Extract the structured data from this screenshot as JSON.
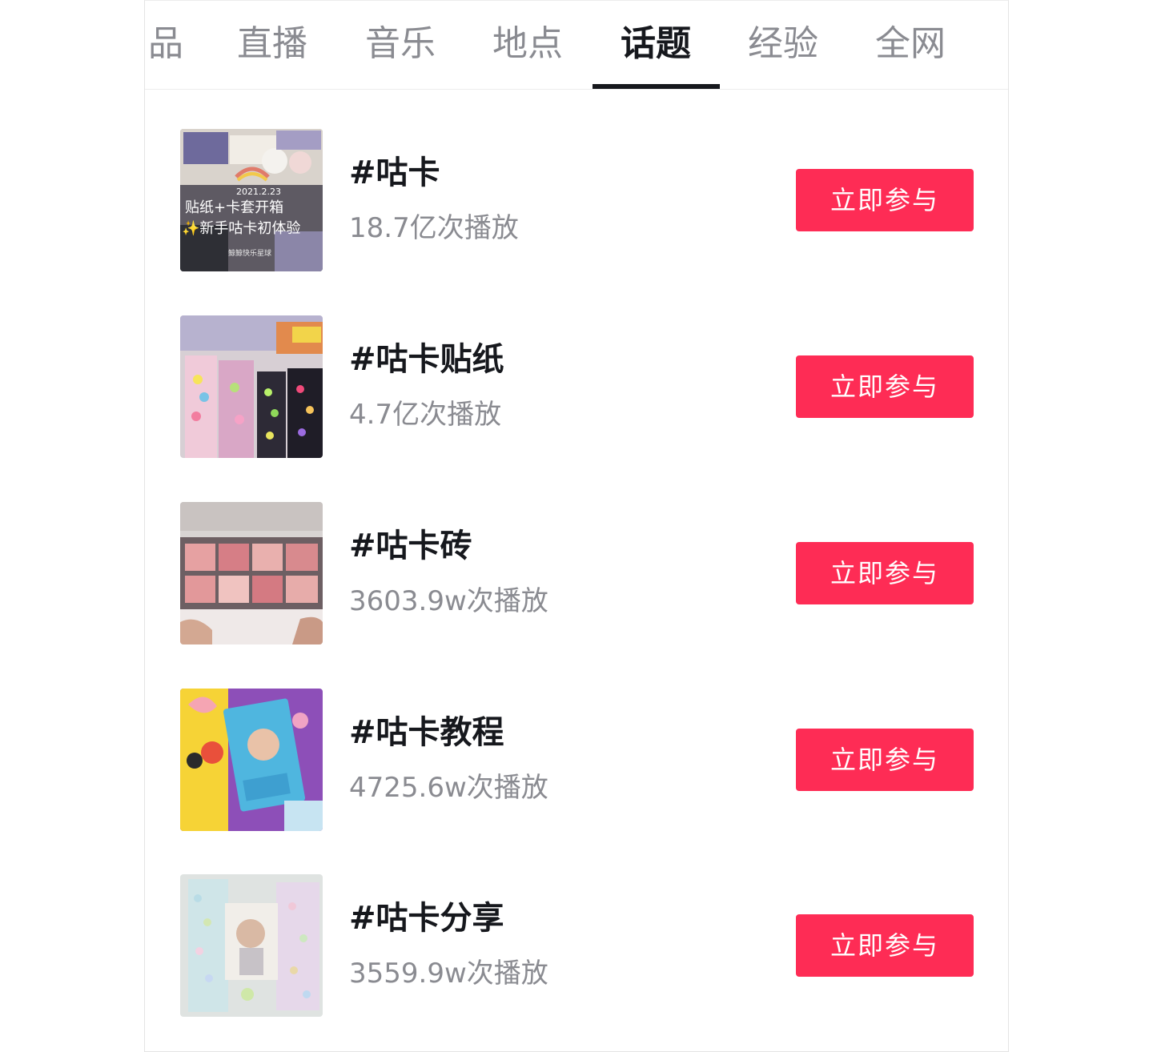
{
  "tabs": [
    {
      "label": "品",
      "active": false
    },
    {
      "label": "直播",
      "active": false
    },
    {
      "label": "音乐",
      "active": false
    },
    {
      "label": "地点",
      "active": false
    },
    {
      "label": "话题",
      "active": true
    },
    {
      "label": "经验",
      "active": false
    },
    {
      "label": "全网",
      "active": false
    }
  ],
  "topics": [
    {
      "title": "#咕卡",
      "views": "18.7亿次播放",
      "button_label": "立即参与",
      "thumbnail": {
        "date": "2021.2.23",
        "line1": "贴纸+卡套开箱",
        "line2": "✨新手咕卡初体验",
        "credit": "鲸鲸快乐星球"
      }
    },
    {
      "title": "#咕卡贴纸",
      "views": "4.7亿次播放",
      "button_label": "立即参与"
    },
    {
      "title": "#咕卡砖",
      "views": "3603.9w次播放",
      "button_label": "立即参与"
    },
    {
      "title": "#咕卡教程",
      "views": "4725.6w次播放",
      "button_label": "立即参与"
    },
    {
      "title": "#咕卡分享",
      "views": "3559.9w次播放",
      "button_label": "立即参与"
    }
  ],
  "colors": {
    "accent": "#fe2c55",
    "title_text": "#16181d",
    "muted_text": "#8a8b91"
  }
}
